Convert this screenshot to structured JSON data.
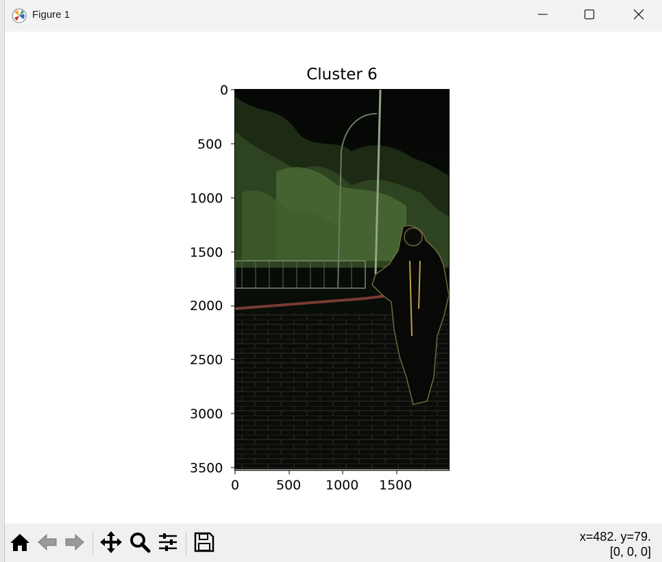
{
  "window": {
    "title": "Figure 1",
    "icon": "matplotlib-icon",
    "controls": [
      "minimize-icon",
      "maximize-icon",
      "close-icon"
    ]
  },
  "figure": {
    "title": "Cluster 6",
    "image_description_colors": {
      "background": "#0a0d06",
      "foliage": "#3d5a2a",
      "edges": "#8a9a6a"
    },
    "y_ticks": [
      "0",
      "500",
      "1000",
      "1500",
      "2000",
      "2500",
      "3000",
      "3500"
    ],
    "x_ticks": [
      "0",
      "500",
      "1000",
      "1500"
    ]
  },
  "toolbar": {
    "buttons": [
      "home-icon",
      "back-icon",
      "forward-icon",
      "pan-icon",
      "zoom-icon",
      "configure-subplots-icon",
      "save-icon"
    ],
    "coords_line1": "x=482. y=79.",
    "coords_line2": "[0, 0, 0]"
  }
}
